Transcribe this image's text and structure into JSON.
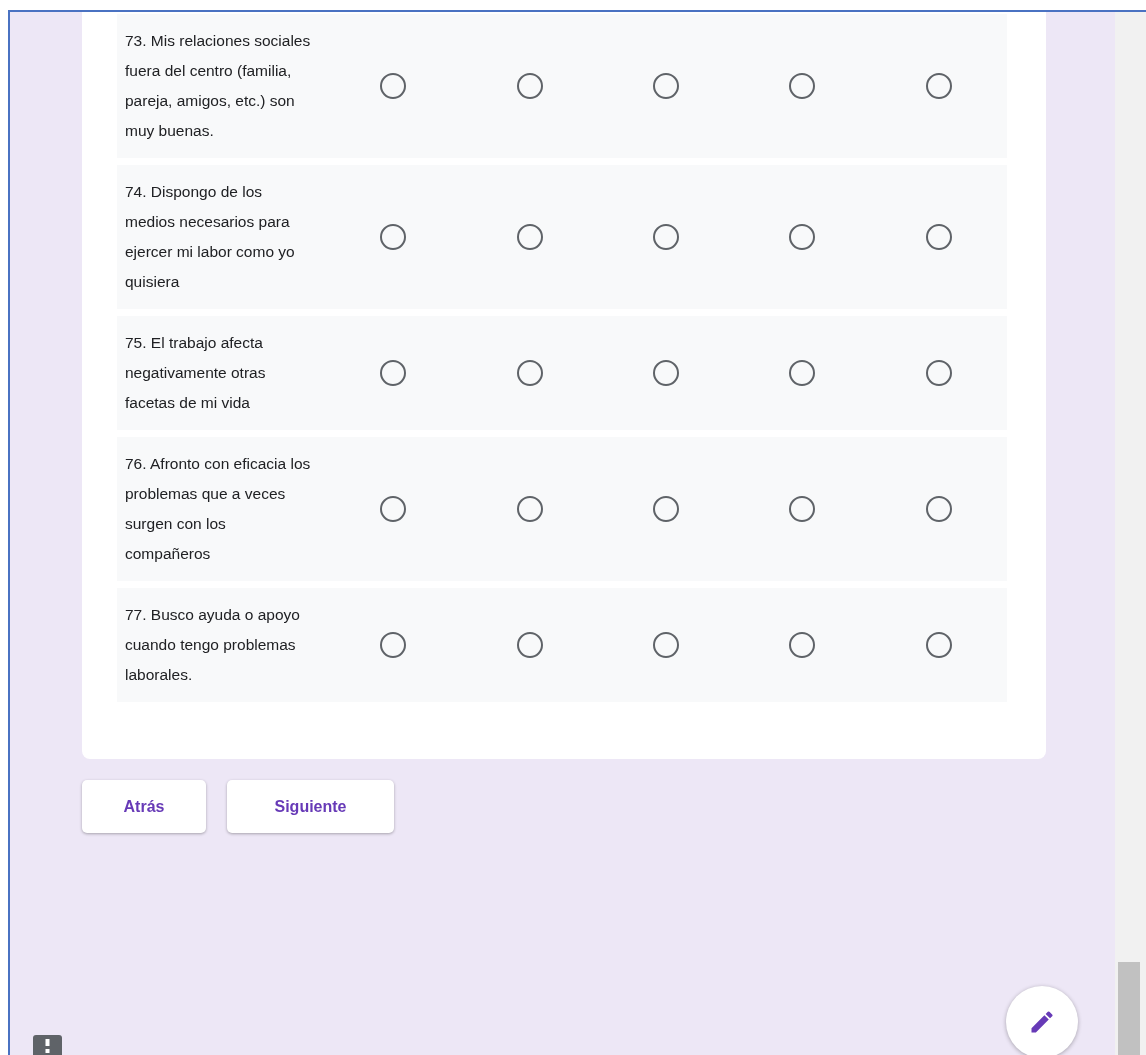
{
  "questions": [
    {
      "text": "73. Mis relaciones sociales fuera del centro (familia, pareja, amigos, etc.) son muy buenas.",
      "options": [
        {
          "selected": false
        },
        {
          "selected": false
        },
        {
          "selected": false
        },
        {
          "selected": false
        },
        {
          "selected": false
        }
      ]
    },
    {
      "text": "74. Dispongo de los medios necesarios para ejercer mi labor como yo quisiera",
      "options": [
        {
          "selected": false
        },
        {
          "selected": false
        },
        {
          "selected": false
        },
        {
          "selected": false
        },
        {
          "selected": false
        }
      ]
    },
    {
      "text": "75. El trabajo afecta negativamente otras facetas de mi vida",
      "options": [
        {
          "selected": false
        },
        {
          "selected": false
        },
        {
          "selected": false
        },
        {
          "selected": false
        },
        {
          "selected": false
        }
      ]
    },
    {
      "text": "76. Afronto con eficacia los problemas que a veces surgen con los compañeros",
      "options": [
        {
          "selected": false
        },
        {
          "selected": false
        },
        {
          "selected": false
        },
        {
          "selected": false
        },
        {
          "selected": false
        }
      ]
    },
    {
      "text": "77. Busco ayuda o apoyo cuando tengo problemas laborales.",
      "options": [
        {
          "selected": false
        },
        {
          "selected": false
        },
        {
          "selected": false
        },
        {
          "selected": false
        },
        {
          "selected": false
        }
      ]
    }
  ],
  "buttons": [
    {
      "label": "Atrás"
    },
    {
      "label": "Siguiente"
    }
  ]
}
